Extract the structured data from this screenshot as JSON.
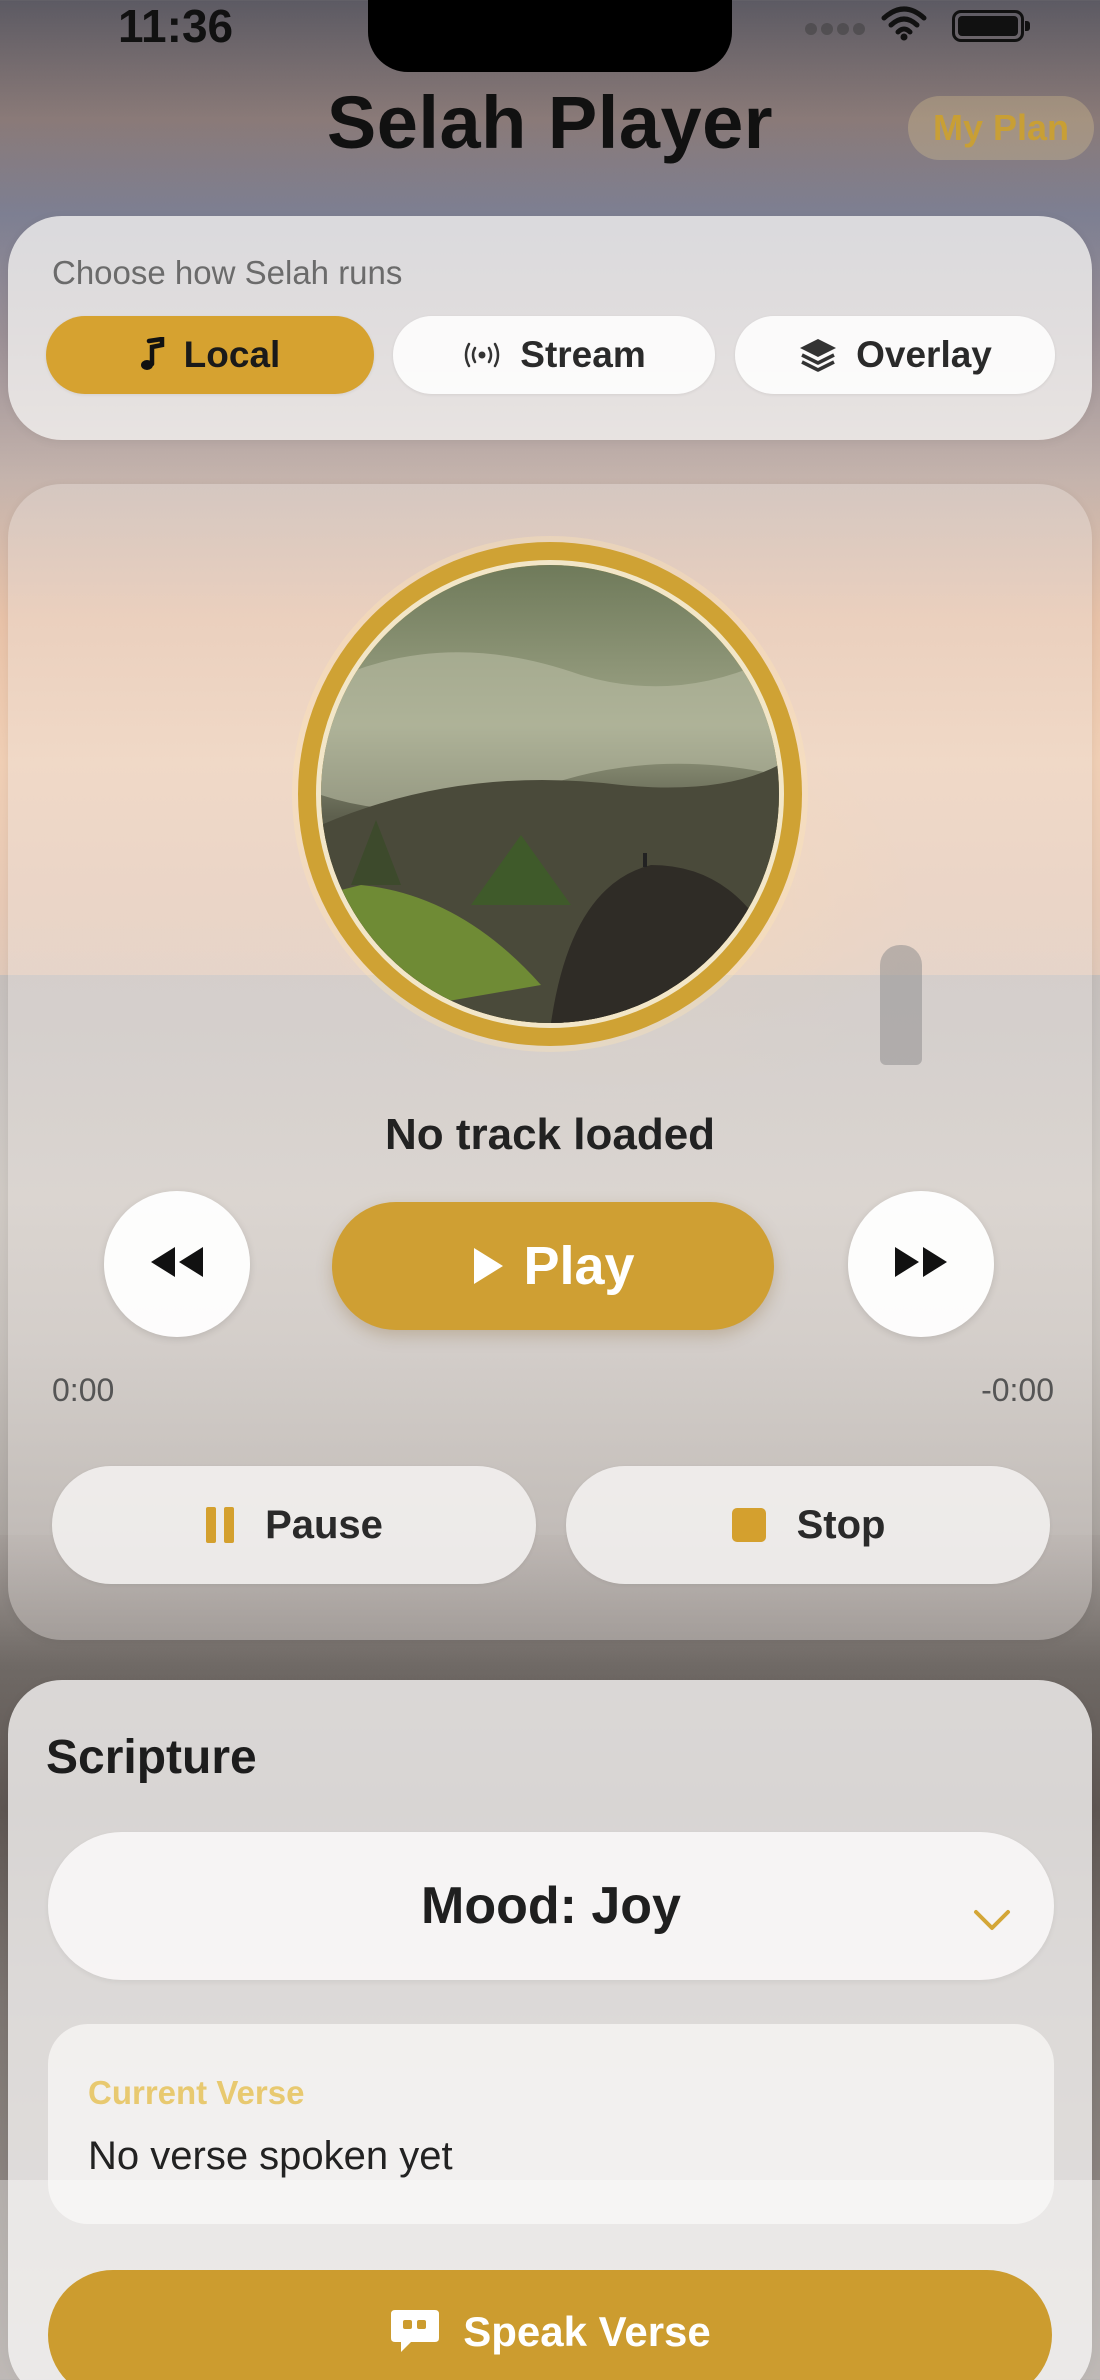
{
  "status_bar": {
    "time": "11:36",
    "icons": [
      "cellular-signal-icon",
      "wifi-icon",
      "battery-icon"
    ]
  },
  "header": {
    "title": "Selah Player",
    "plan_button": "My Plan"
  },
  "mode_selector": {
    "caption": "Choose how Selah runs",
    "options": [
      {
        "label": "Local",
        "icon": "music-note-icon",
        "selected": true
      },
      {
        "label": "Stream",
        "icon": "broadcast-icon",
        "selected": false
      },
      {
        "label": "Overlay",
        "icon": "layers-icon",
        "selected": false
      }
    ]
  },
  "player": {
    "track_title": "No track loaded",
    "play_label": "Play",
    "time_elapsed": "0:00",
    "time_remaining": "-0:00",
    "pause_label": "Pause",
    "stop_label": "Stop",
    "icons": {
      "rewind": "rewind-icon",
      "forward": "fast-forward-icon",
      "play": "play-icon",
      "pause": "pause-icon",
      "stop": "stop-icon"
    }
  },
  "scripture": {
    "title": "Scripture",
    "mood_select_value": "Mood: Joy",
    "current_verse_label": "Current Verse",
    "current_verse_text": "No verse spoken yet",
    "speak_label": "Speak Verse",
    "speak_icon": "quote-bubble-icon"
  },
  "colors": {
    "accent": "#d6a230",
    "accent_dark": "#cc9c2f",
    "verse_label": "#e8c970"
  }
}
